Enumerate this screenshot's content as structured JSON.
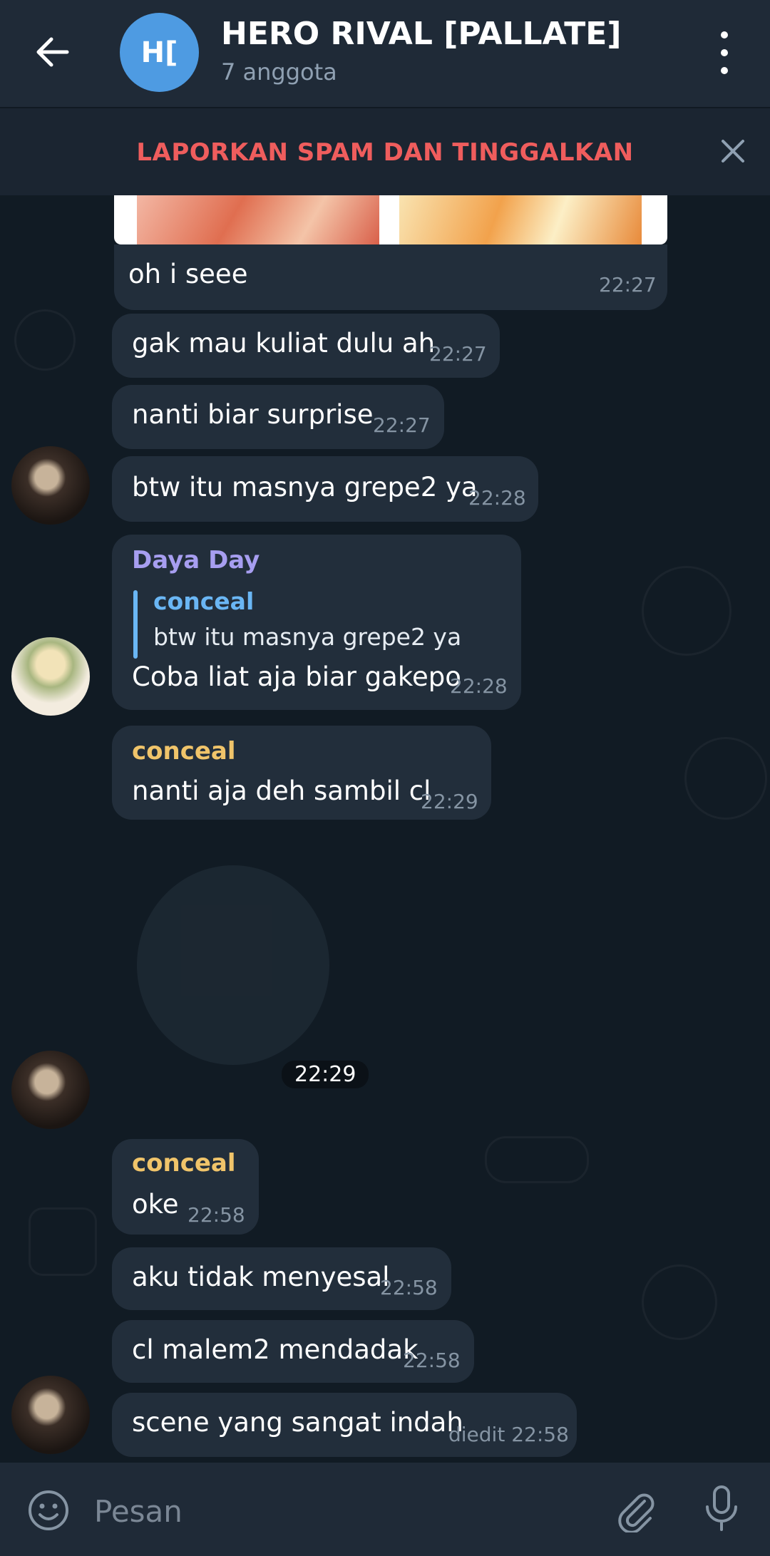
{
  "header": {
    "avatar_initials": "H[",
    "title": "HERO RIVAL [PALLATE]",
    "subtitle": "7 anggota"
  },
  "spam_bar": {
    "label": "LAPORKAN SPAM DAN TINGGALKAN"
  },
  "messages": [
    {
      "text": "oh i seee",
      "time": "22:27"
    },
    {
      "text": "gak mau kuliat dulu ah",
      "time": "22:27"
    },
    {
      "text": "nanti biar surprise",
      "time": "22:27"
    },
    {
      "text": "btw itu masnya grepe2 ya",
      "time": "22:28"
    },
    {
      "sender": "Daya Day",
      "reply_to": "conceal",
      "reply_text": "btw itu masnya grepe2 ya",
      "text": "Coba liat aja biar gakepo",
      "time": "22:28"
    },
    {
      "sender": "conceal",
      "text": "nanti aja deh sambil cl",
      "time": "22:29"
    },
    {
      "sticker_time": "22:29"
    },
    {
      "sender": "conceal",
      "text": "oke",
      "time": "22:58"
    },
    {
      "text": "aku tidak menyesal",
      "time": "22:58"
    },
    {
      "text": "cl malem2 mendadak",
      "time": "22:58"
    },
    {
      "text": "scene yang sangat indah",
      "time": "diedit 22:58"
    }
  ],
  "colors": {
    "daya_name": "#a79ef0",
    "conceal_name": "#f0c46a",
    "reply_name": "#6ab6f4",
    "spam_red": "#ef5d5d"
  },
  "input": {
    "placeholder": "Pesan"
  },
  "icons": [
    "back-arrow-icon",
    "more-vert-icon",
    "close-icon",
    "emoji-icon",
    "attach-icon",
    "mic-icon"
  ]
}
